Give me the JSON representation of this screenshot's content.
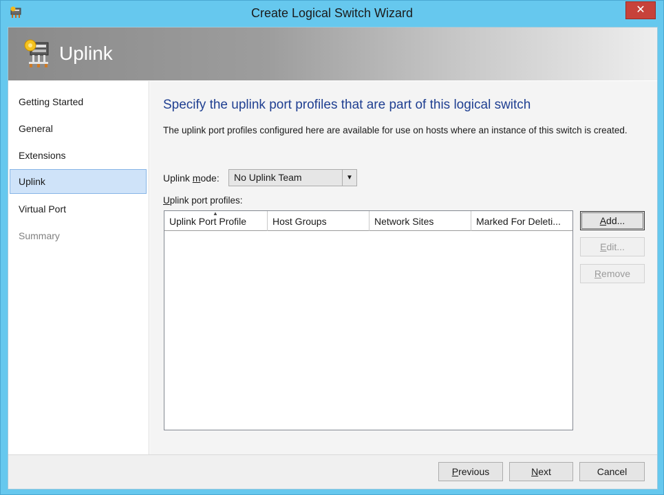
{
  "window": {
    "title": "Create Logical Switch Wizard",
    "close_glyph": "✕"
  },
  "banner": {
    "title": "Uplink",
    "icon": "switch-gear-icon"
  },
  "nav": {
    "items": [
      {
        "label": "Getting Started",
        "state": "normal"
      },
      {
        "label": "General",
        "state": "normal"
      },
      {
        "label": "Extensions",
        "state": "normal"
      },
      {
        "label": "Uplink",
        "state": "selected"
      },
      {
        "label": "Virtual Port",
        "state": "normal"
      },
      {
        "label": "Summary",
        "state": "disabled"
      }
    ]
  },
  "main": {
    "heading": "Specify the uplink port profiles that are part of this logical switch",
    "description": "The uplink port profiles configured here are available for use on hosts where an instance of this switch is created.",
    "uplink_mode": {
      "label_pre": "Uplink ",
      "label_accel": "m",
      "label_post": "ode:",
      "value": "No Uplink Team"
    },
    "profiles": {
      "label_accel": "U",
      "label_rest": "plink port profiles:",
      "columns": [
        "Uplink Port Profile",
        "Host Groups",
        "Network Sites",
        "Marked For Deleti..."
      ],
      "rows": []
    },
    "buttons": {
      "add": {
        "accel": "A",
        "rest": "dd..."
      },
      "edit": {
        "accel": "E",
        "rest": "dit..."
      },
      "remove": {
        "accel": "R",
        "rest": "emove"
      }
    }
  },
  "footer": {
    "previous": {
      "accel": "P",
      "rest": "revious"
    },
    "next": {
      "accel": "N",
      "rest": "ext"
    },
    "cancel": "Cancel"
  },
  "colors": {
    "frame": "#66c8ee",
    "heading": "#1f3f91",
    "close": "#c7423a",
    "selected_nav": "#cfe3f9"
  }
}
